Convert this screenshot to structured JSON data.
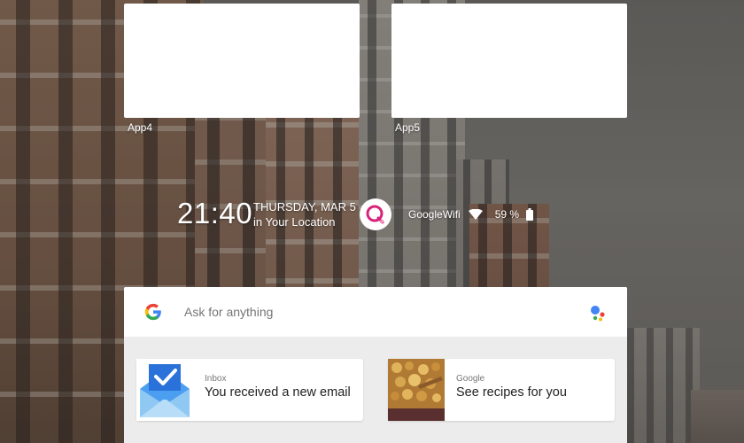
{
  "apps": [
    {
      "label": "App4"
    },
    {
      "label": "App5"
    }
  ],
  "clock": {
    "time": "21:40",
    "date": "THURSDAY, MAR 5",
    "location": "in Your Location"
  },
  "status": {
    "network": "GoogleWifi",
    "battery": "59 %"
  },
  "search": {
    "placeholder": "Ask for anything"
  },
  "cards": [
    {
      "source": "Inbox",
      "title": "You received a new email",
      "icon": "inbox-envelope-icon"
    },
    {
      "source": "Google",
      "title": "See recipes for you",
      "icon": "food-photo"
    }
  ],
  "colors": {
    "accent_pink": "#d6247a",
    "google_blue": "#4285F4",
    "google_red": "#EA4335",
    "google_yellow": "#FBBC05",
    "google_green": "#34A853"
  }
}
